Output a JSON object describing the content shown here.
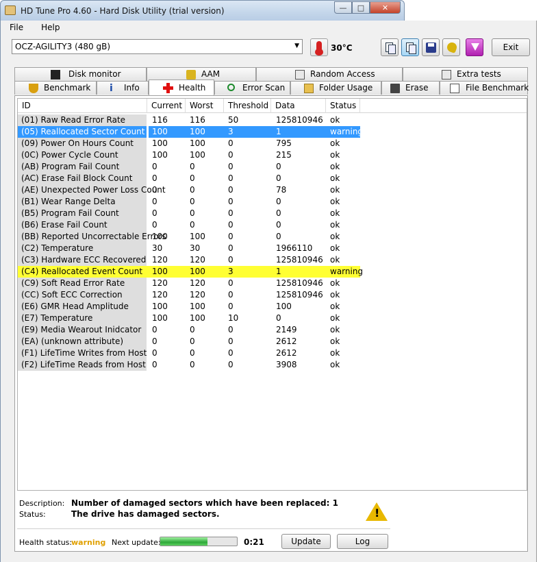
{
  "window": {
    "title": "HD Tune Pro 4.60 - Hard Disk Utility (trial version)"
  },
  "menu": {
    "file": "File",
    "help": "Help"
  },
  "drive": {
    "selected": "OCZ-AGILITY3 (480 gB)"
  },
  "temperature": "30°C",
  "toolbar": {
    "exit": "Exit"
  },
  "tabs_top": [
    {
      "label": "Disk monitor"
    },
    {
      "label": "AAM"
    },
    {
      "label": "Random Access"
    },
    {
      "label": "Extra tests"
    }
  ],
  "tabs_bottom": [
    {
      "label": "Benchmark"
    },
    {
      "label": "Info"
    },
    {
      "label": "Health",
      "selected": true
    },
    {
      "label": "Error Scan"
    },
    {
      "label": "Folder Usage"
    },
    {
      "label": "Erase"
    },
    {
      "label": "File Benchmark"
    }
  ],
  "table": {
    "headers": [
      "ID",
      "Current",
      "Worst",
      "Threshold",
      "Data",
      "Status"
    ],
    "rows": [
      [
        "(01) Raw Read Error Rate",
        "116",
        "116",
        "50",
        "125810946",
        "ok"
      ],
      [
        "(05) Reallocated Sector Count",
        "100",
        "100",
        "3",
        "1",
        "warning"
      ],
      [
        "(09) Power On Hours Count",
        "100",
        "100",
        "0",
        "795",
        "ok"
      ],
      [
        "(0C) Power Cycle Count",
        "100",
        "100",
        "0",
        "215",
        "ok"
      ],
      [
        "(AB) Program Fail Count",
        "0",
        "0",
        "0",
        "0",
        "ok"
      ],
      [
        "(AC) Erase Fail Block Count",
        "0",
        "0",
        "0",
        "0",
        "ok"
      ],
      [
        "(AE) Unexpected Power Loss Count",
        "0",
        "0",
        "0",
        "78",
        "ok"
      ],
      [
        "(B1) Wear Range Delta",
        "0",
        "0",
        "0",
        "0",
        "ok"
      ],
      [
        "(B5) Program Fail Count",
        "0",
        "0",
        "0",
        "0",
        "ok"
      ],
      [
        "(B6) Erase Fail Count",
        "0",
        "0",
        "0",
        "0",
        "ok"
      ],
      [
        "(BB) Reported Uncorrectable Errors",
        "100",
        "100",
        "0",
        "0",
        "ok"
      ],
      [
        "(C2) Temperature",
        "30",
        "30",
        "0",
        "1966110",
        "ok"
      ],
      [
        "(C3) Hardware ECC Recovered",
        "120",
        "120",
        "0",
        "125810946",
        "ok"
      ],
      [
        "(C4) Reallocated Event Count",
        "100",
        "100",
        "3",
        "1",
        "warning"
      ],
      [
        "(C9) Soft Read Error Rate",
        "120",
        "120",
        "0",
        "125810946",
        "ok"
      ],
      [
        "(CC) Soft ECC Correction",
        "120",
        "120",
        "0",
        "125810946",
        "ok"
      ],
      [
        "(E6) GMR Head Amplitude",
        "100",
        "100",
        "0",
        "100",
        "ok"
      ],
      [
        "(E7) Temperature",
        "100",
        "100",
        "10",
        "0",
        "ok"
      ],
      [
        "(E9) Media Wearout Inidcator",
        "0",
        "0",
        "0",
        "2149",
        "ok"
      ],
      [
        "(EA) (unknown attribute)",
        "0",
        "0",
        "0",
        "2612",
        "ok"
      ],
      [
        "(F1) LifeTime Writes from Host",
        "0",
        "0",
        "0",
        "2612",
        "ok"
      ],
      [
        "(F2) LifeTime Reads from Host",
        "0",
        "0",
        "0",
        "3908",
        "ok"
      ]
    ]
  },
  "details": {
    "description_label": "Description:",
    "description": "Number of damaged sectors which have been replaced: 1",
    "status_label": "Status:",
    "status": "The drive has damaged sectors."
  },
  "footer": {
    "health_label": "Health status:",
    "health_value": "warning",
    "next_label": "Next update:",
    "progress": 0.62,
    "countdown": "0:21",
    "update": "Update",
    "log": "Log"
  },
  "colors": {
    "selected": "#3399ff",
    "warning_row": "#ffff33",
    "warning_text": "#e0a000"
  }
}
